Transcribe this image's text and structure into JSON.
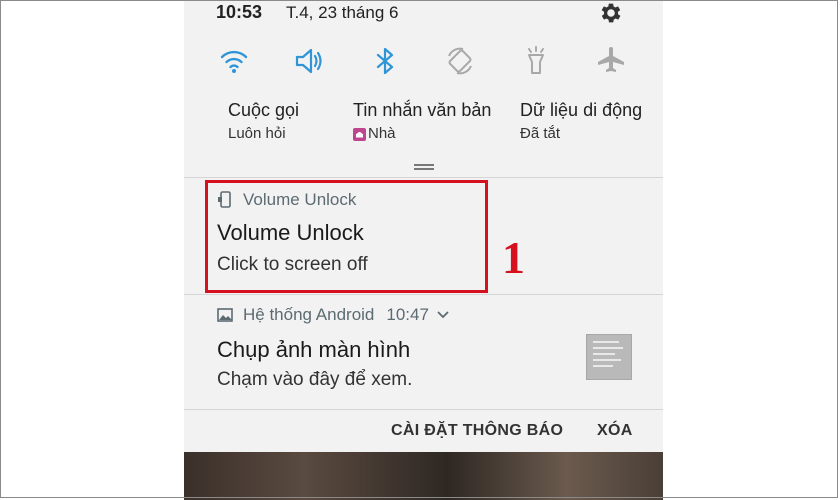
{
  "status_bar": {
    "time": "10:53",
    "date": "T.4, 23 tháng 6",
    "settings_icon": "gear-icon"
  },
  "quick_settings": [
    {
      "name": "wifi",
      "icon": "wifi-icon",
      "active": true
    },
    {
      "name": "sound",
      "icon": "speaker-icon",
      "active": true
    },
    {
      "name": "bluetooth",
      "icon": "bluetooth-icon",
      "active": true
    },
    {
      "name": "auto-rotate",
      "icon": "rotate-icon",
      "active": false
    },
    {
      "name": "flashlight",
      "icon": "flashlight-icon",
      "active": false
    },
    {
      "name": "airplane",
      "icon": "airplane-icon",
      "active": false
    }
  ],
  "info": {
    "calls": {
      "title": "Cuộc gọi",
      "sub": "Luôn hỏi"
    },
    "messages": {
      "title": "Tin nhắn văn bản",
      "sub": "Nhà"
    },
    "data": {
      "title": "Dữ liệu di động",
      "sub": "Đã tắt"
    }
  },
  "notifications": [
    {
      "app": "Volume Unlock",
      "title": "Volume Unlock",
      "text": "Click to screen off"
    },
    {
      "app": "Hệ thống Android",
      "time": "10:47",
      "title": "Chụp ảnh màn hình",
      "text": "Chạm vào đây để xem."
    }
  ],
  "actions": {
    "settings": "CÀI ĐẶT THÔNG BÁO",
    "clear": "XÓA"
  },
  "annotation": {
    "step": "1"
  },
  "colors": {
    "accent": "#2f95d6",
    "inactive": "#a8a8a8",
    "highlight": "#d5101f"
  }
}
